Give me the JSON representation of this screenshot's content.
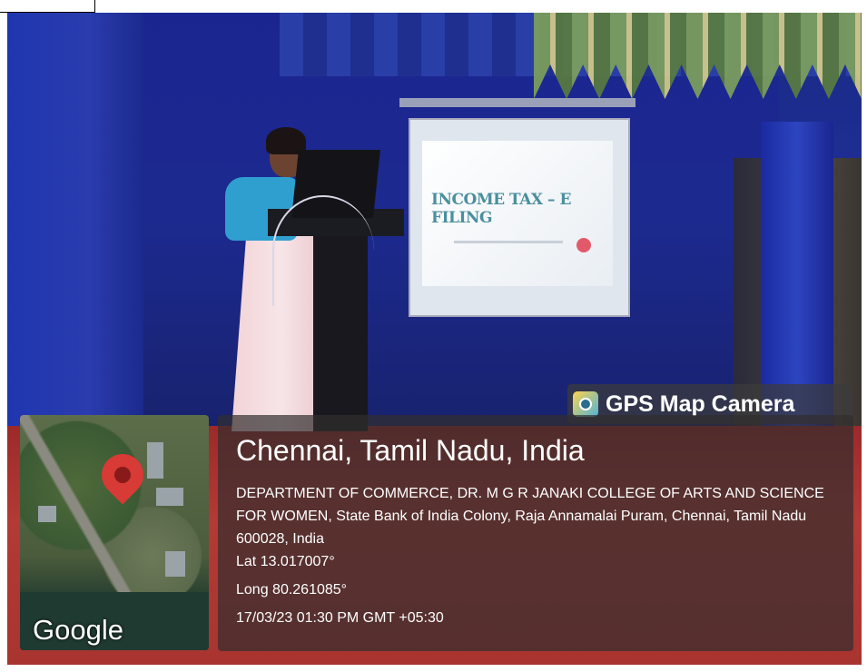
{
  "overlay": {
    "app_name": "GPS Map Camera",
    "app_icon": "gps-map-camera-icon",
    "map_provider": "Google",
    "location_title": "Chennai, Tamil Nadu, India",
    "address": "DEPARTMENT OF COMMERCE, DR. M G R JANAKI COLLEGE OF ARTS AND SCIENCE FOR WOMEN, State Bank of India Colony, Raja Annamalai Puram, Chennai, Tamil Nadu 600028, India",
    "latitude": "Lat 13.017007°",
    "longitude": "Long 80.261085°",
    "timestamp": "17/03/23 01:30 PM GMT +05:30"
  },
  "scene": {
    "slide_text": "INCOME TAX – E FILING"
  },
  "colors": {
    "pin": "#d83a35",
    "overlay_bg": "#3a3535",
    "text": "#ffffff"
  }
}
